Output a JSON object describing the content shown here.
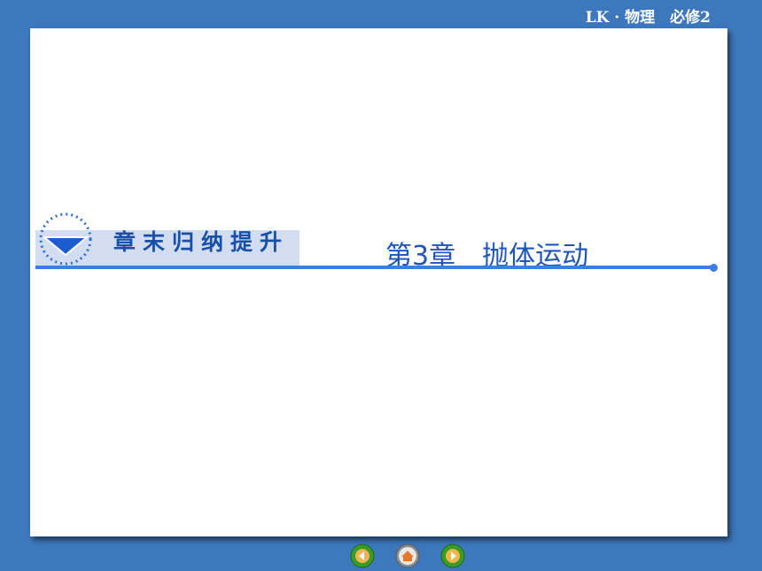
{
  "header": {
    "label": "LK · 物理　必修2"
  },
  "banner": {
    "text": "章末归纳提升"
  },
  "chapter": {
    "title": "第3章　抛体运动"
  },
  "nav": {
    "prev_icon": "arrow-left-icon",
    "home_icon": "home-icon",
    "next_icon": "arrow-right-icon"
  },
  "colors": {
    "background": "#3d78bc",
    "accent": "#3b7fe0",
    "banner_band": "#d2ddf1",
    "title_text": "#1f55b8"
  }
}
